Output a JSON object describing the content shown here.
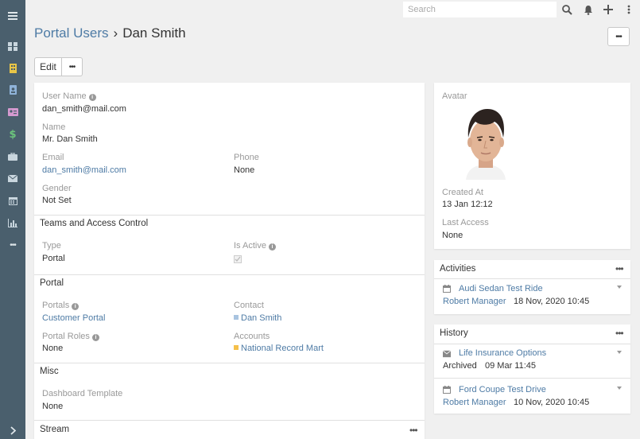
{
  "search": {
    "placeholder": "Search"
  },
  "breadcrumb": {
    "parent": "Portal Users",
    "separator": "›",
    "current": "Dan Smith"
  },
  "buttons": {
    "edit": "Edit",
    "more": "•••",
    "header_more": "•••"
  },
  "fields": {
    "user_name": {
      "label": "User Name",
      "value": "dan_smith@mail.com"
    },
    "name": {
      "label": "Name",
      "value": "Mr. Dan Smith"
    },
    "email": {
      "label": "Email",
      "value": "dan_smith@mail.com"
    },
    "phone": {
      "label": "Phone",
      "value": "None"
    },
    "gender": {
      "label": "Gender",
      "value": "Not Set"
    }
  },
  "sections": {
    "teams": {
      "title": "Teams and Access Control",
      "type": {
        "label": "Type",
        "value": "Portal"
      },
      "is_active": {
        "label": "Is Active",
        "checked": true
      }
    },
    "portal": {
      "title": "Portal",
      "portals": {
        "label": "Portals",
        "value": "Customer Portal"
      },
      "contact": {
        "label": "Contact",
        "value": "Dan Smith",
        "color": "#a9c4e0"
      },
      "portal_roles": {
        "label": "Portal Roles",
        "value": "None"
      },
      "accounts": {
        "label": "Accounts",
        "value": "National Record Mart",
        "color": "#f5c04a"
      }
    },
    "misc": {
      "title": "Misc",
      "dashboard_template": {
        "label": "Dashboard Template",
        "value": "None"
      }
    },
    "stream": {
      "title": "Stream"
    }
  },
  "side": {
    "avatar": {
      "label": "Avatar"
    },
    "created_at": {
      "label": "Created At",
      "value": "13 Jan 12:12"
    },
    "last_access": {
      "label": "Last Access",
      "value": "None"
    },
    "activities": {
      "title": "Activities",
      "items": [
        {
          "title": "Audi Sedan Test Ride",
          "user": "Robert Manager",
          "date": "18 Nov, 2020 10:45"
        }
      ]
    },
    "history": {
      "title": "History",
      "items": [
        {
          "title": "Life Insurance Options",
          "status": "Archived",
          "date": "09 Mar 11:45"
        },
        {
          "title": "Ford Coupe Test Drive",
          "user": "Robert Manager",
          "date": "10 Nov, 2020 10:45"
        }
      ]
    }
  },
  "sidebar": {
    "icons": [
      "menu-icon",
      "dashboard-icon",
      "building-icon",
      "contact-book-icon",
      "id-card-icon",
      "dollar-icon",
      "briefcase-icon",
      "envelope-icon",
      "calendar-icon",
      "bar-chart-icon",
      "more-icon",
      "chevron-right-icon"
    ],
    "more": "•••"
  },
  "colors": {
    "sidebar": "#4a5f6d",
    "link": "#4e7ba5",
    "label": "#999999"
  }
}
